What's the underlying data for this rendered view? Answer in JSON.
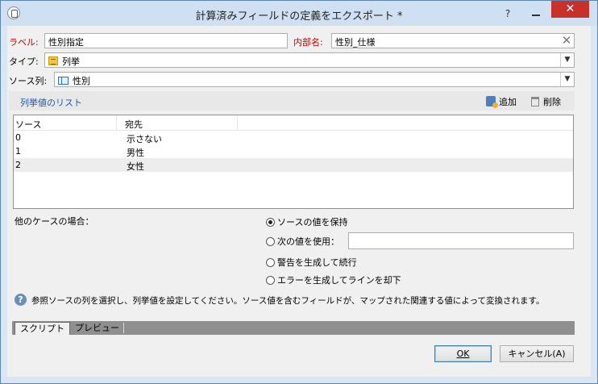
{
  "window": {
    "title": "計算済みフィールドの定義をエクスポート *",
    "help_glyph": "?",
    "close_glyph": "✕"
  },
  "form": {
    "label_caption": "ラベル:",
    "label_value": "性別指定",
    "internal_caption": "内部名:",
    "internal_value": "性別_仕様",
    "clear_glyph": "✕",
    "type_caption": "タイプ:",
    "type_value": "列挙",
    "source_caption": "ソース列:",
    "source_value": "性別"
  },
  "enum_section": {
    "title": "列挙値のリスト",
    "add_label": "追加",
    "delete_label": "削除"
  },
  "table": {
    "columns": [
      "ソース",
      "宛先"
    ],
    "rows": [
      {
        "source": "0",
        "dest": "示さない"
      },
      {
        "source": "1",
        "dest": "男性"
      },
      {
        "source": "2",
        "dest": "女性"
      }
    ]
  },
  "other_cases": {
    "caption": "他のケースの場合：",
    "options": [
      {
        "label": "ソースの値を保持",
        "selected": true
      },
      {
        "label": "次の値を使用：",
        "selected": false
      },
      {
        "label": "警告を生成して続行",
        "selected": false
      },
      {
        "label": "エラーを生成してラインを却下",
        "selected": false
      }
    ],
    "value_input": ""
  },
  "help": {
    "icon": "?",
    "text": "参照ソースの列を選択し、列挙値を設定してください。ソース値を含むフィールドが、マップされた関連する値によって変換されます。"
  },
  "tabs": [
    "スクリプト",
    "プレビュー"
  ],
  "buttons": {
    "ok_label": "OK",
    "cancel_label": "キャンセル(A)"
  },
  "colors": {
    "accent_link": "#2158a8",
    "required_label": "#c00000",
    "close_button": "#c7312a"
  }
}
